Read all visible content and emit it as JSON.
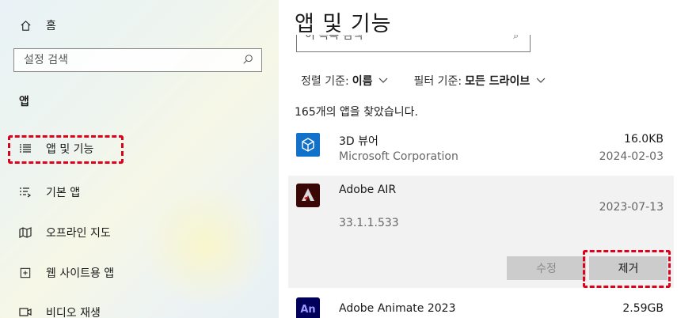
{
  "sidebar": {
    "home_label": "홈",
    "search_placeholder": "설정 검색",
    "section_title": "앱",
    "nav_items": [
      {
        "label": "앱 및 기능",
        "icon": "apps-features-icon"
      },
      {
        "label": "기본 앱",
        "icon": "default-apps-icon"
      },
      {
        "label": "오프라인 지도",
        "icon": "offline-maps-icon"
      },
      {
        "label": "웹 사이트용 앱",
        "icon": "web-apps-icon"
      },
      {
        "label": "비디오 재생",
        "icon": "video-playback-icon"
      }
    ]
  },
  "main": {
    "title": "앱 및 기능",
    "sort_search_partial": "이 목록 검색",
    "sort_label": "정렬 기준:",
    "sort_value": "이름",
    "filter_label": "필터 기준:",
    "filter_value": "모든 드라이브",
    "result_count": "165개의 앱을 찾았습니다.",
    "apps": [
      {
        "name": "3D 뷰어",
        "publisher": "Microsoft Corporation",
        "size": "16.0KB",
        "date": "2024-02-03",
        "icon": "3d-viewer-icon"
      },
      {
        "name": "Adobe AIR",
        "version": "33.1.1.533",
        "date": "2023-07-13",
        "icon": "adobe-air-icon",
        "modify_label": "수정",
        "uninstall_label": "제거"
      },
      {
        "name": "Adobe Animate 2023",
        "size": "2.59GB",
        "icon": "adobe-animate-icon",
        "icon_text": "An"
      }
    ]
  },
  "colors": {
    "highlight": "#e0001a",
    "button_bg": "#cccccc",
    "selected_row_bg": "#f2f2f2",
    "viewer_icon_bg": "#1272c9"
  }
}
